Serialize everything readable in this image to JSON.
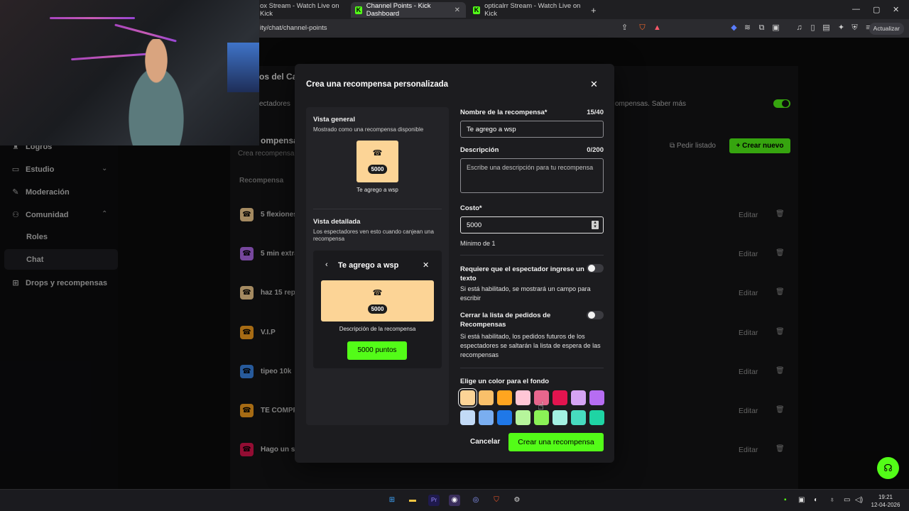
{
  "browser": {
    "tabs": [
      {
        "label": "ox Stream - Watch Live on Kick"
      },
      {
        "label": "Channel Points - Kick Dashboard"
      },
      {
        "label": "opticalrr Stream - Watch Live on Kick"
      }
    ],
    "url": "ity/chat/channel-points",
    "update_label": "Actualizar"
  },
  "sidebar": {
    "items": [
      {
        "label": "Logros"
      },
      {
        "label": "Estudio"
      },
      {
        "label": "Moderación"
      },
      {
        "label": "Comunidad"
      },
      {
        "label": "Roles"
      },
      {
        "label": "Chat"
      },
      {
        "label": "Drops y recompensas"
      }
    ]
  },
  "dashboard": {
    "header_partial": "os del Ca",
    "spectators_partial": "ectadores",
    "enabled_partial": "ompensas. Saber más",
    "rewards_title_partial": "ompensas",
    "rewards_sub_partial": "Crea recompensa",
    "request_list": "Pedir listado",
    "create_new": "Crear nuevo",
    "column_reward": "Recompensa",
    "edit_label": "Editar",
    "rewards": [
      {
        "name": "5 flexiones",
        "color": "#fcd496"
      },
      {
        "name": "5 min extra",
        "color": "#b66df2"
      },
      {
        "name": "haz 15 rep",
        "color": "#fcd496"
      },
      {
        "name": "V.I.P",
        "color": "#ffa51f"
      },
      {
        "name": "tipeo 10k",
        "color": "#3c8aef"
      },
      {
        "name": "TE COMPR",
        "color": "#ffa51f"
      },
      {
        "name": "Hago un st",
        "color": "#e2144f"
      }
    ]
  },
  "modal": {
    "title": "Crea una recompensa personalizada",
    "overview": {
      "heading": "Vista general",
      "subtitle": "Mostrado como una recompensa disponible",
      "cost": "5000",
      "name": "Te agrego a wsp"
    },
    "detail": {
      "heading": "Vista detallada",
      "subtitle": "Los espectadores ven esto cuando canjean una recompensa",
      "title": "Te agrego a wsp",
      "cost": "5000",
      "description": "Descripción de la recompensa",
      "button": "5000 puntos"
    },
    "form": {
      "name_label": "Nombre de la recompensa*",
      "name_count": "15/40",
      "name_value": "Te agrego a wsp",
      "desc_label": "Descripción",
      "desc_count": "0/200",
      "desc_placeholder": "Escribe una descripción para tu recompensa",
      "cost_label": "Costo*",
      "cost_value": "5000",
      "cost_min": "Mínimo de 1",
      "require_text_label": "Requiere que el espectador ingrese un texto",
      "require_text_help": "Si está habilitado, se mostrará un campo para escribir",
      "close_list_label": "Cerrar la lista de pedidos de Recompensas",
      "close_list_help": "Si está habilitado, los pedidos futuros de los espectadores se saltarán la lista de espera de las recompensas",
      "color_label": "Elige un color para el fondo",
      "colors": [
        "#fcd496",
        "#f9c06a",
        "#ffa51f",
        "#ffc6d6",
        "#e8668d",
        "#e2144f",
        "#d5a4f4",
        "#b66df2",
        "#c2daf6",
        "#7aaef0",
        "#1f78e8",
        "#b6f59b",
        "#8af256",
        "#a3f1e2",
        "#47dbbf",
        "#1fd4a4"
      ],
      "selected_color": "#fcd496"
    },
    "cancel": "Cancelar",
    "create": "Crear una recompensa"
  },
  "taskbar": {
    "time": "19:21",
    "date": "12-04-2026"
  }
}
